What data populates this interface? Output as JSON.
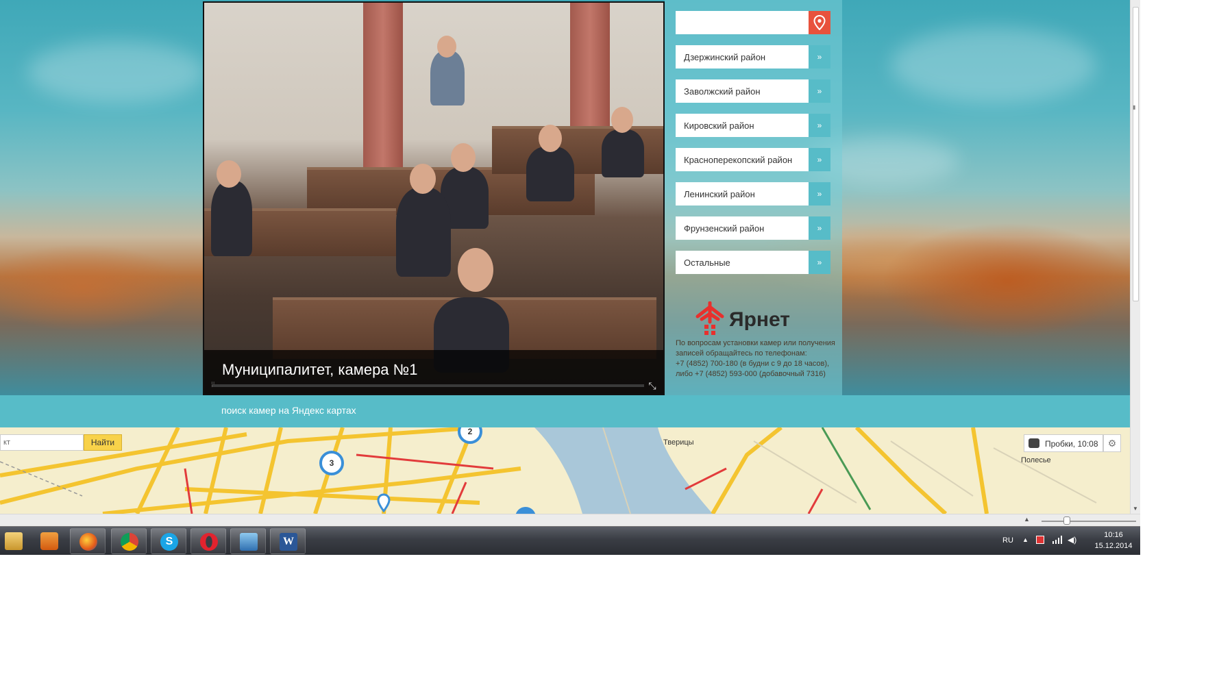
{
  "video": {
    "caption": "Муниципалитет, камера №1"
  },
  "sidebar": {
    "search": {
      "value": "",
      "placeholder": ""
    },
    "districts": [
      {
        "label": "Дзержинский район"
      },
      {
        "label": "Заволжский район"
      },
      {
        "label": "Кировский район"
      },
      {
        "label": "Красноперекопский район"
      },
      {
        "label": "Ленинский район"
      },
      {
        "label": "Фрунзенский район"
      },
      {
        "label": "Остальные"
      }
    ],
    "logo_text": "Ярнет",
    "contact": {
      "line1": "По вопросам установки камер или получения",
      "line2": "записей обращайтесь по телефонам:",
      "line3": "+7 (4852) 700-180 (в будни с 9 до 18 часов),",
      "line4": "либо +7 (4852) 593-000 (добавочный 7316)"
    }
  },
  "map_strip": {
    "link": "поиск камер на Яндекс картах"
  },
  "map": {
    "search_value": "кт",
    "find_label": "Найти",
    "traffic_label": "Пробки, 10:08",
    "labels": {
      "tveritsy": "Тверицы",
      "polesye": "Полесье"
    },
    "clusters": [
      {
        "count": "3"
      },
      {
        "count": "2"
      }
    ]
  },
  "taskbar": {
    "lang": "RU",
    "time": "10:16",
    "date": "15.12.2014",
    "apps": [
      "explorer-icon",
      "media-player-icon",
      "firefox-icon",
      "chrome-icon",
      "skype-icon",
      "opera-icon",
      "photo-viewer-icon",
      "word-icon"
    ]
  },
  "colors": {
    "accent_teal": "#57bcc8",
    "search_red": "#e8523d",
    "find_yellow": "#f8d24a"
  }
}
